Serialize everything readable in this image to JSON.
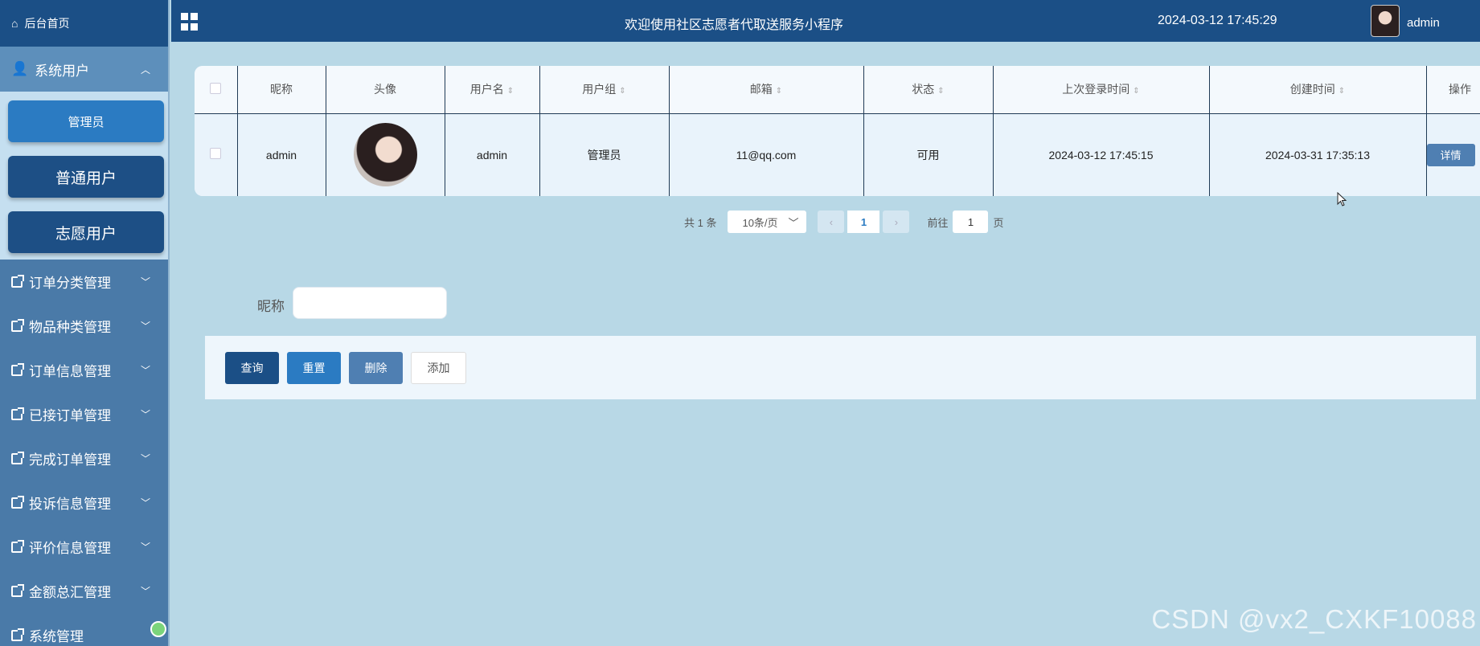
{
  "sidebar": {
    "home": "后台首页",
    "group": "系统用户",
    "submenu": [
      "管理员",
      "普通用户",
      "志愿用户"
    ],
    "items": [
      "订单分类管理",
      "物品种类管理",
      "订单信息管理",
      "已接订单管理",
      "完成订单管理",
      "投诉信息管理",
      "评价信息管理",
      "金额总汇管理",
      "系统管理"
    ]
  },
  "header": {
    "title": "欢迎使用社区志愿者代取送服务小程序",
    "time": "2024-03-12 17:45:29",
    "user": "admin"
  },
  "table": {
    "columns": [
      "昵称",
      "头像",
      "用户名",
      "用户组",
      "邮箱",
      "状态",
      "上次登录时间",
      "创建时间",
      "操作"
    ],
    "rows": [
      {
        "nickname": "admin",
        "username": "admin",
        "group": "管理员",
        "email": "11@qq.com",
        "status": "可用",
        "last_login": "2024-03-12 17:45:15",
        "created": "2024-03-31 17:35:13",
        "action": "详情"
      }
    ]
  },
  "pager": {
    "total": "共 1 条",
    "size": "10条/页",
    "current": "1",
    "goto_label": "前往",
    "goto_value": "1",
    "goto_suffix": "页"
  },
  "search": {
    "label": "昵称",
    "value": ""
  },
  "buttons": {
    "query": "查询",
    "reset": "重置",
    "delete": "删除",
    "add": "添加"
  },
  "watermark": "CSDN @vx2_CXKF10088",
  "colors": {
    "nav_dark": "#1b4f86",
    "accent": "#2b7bc2",
    "background": "#b8d8e6"
  }
}
